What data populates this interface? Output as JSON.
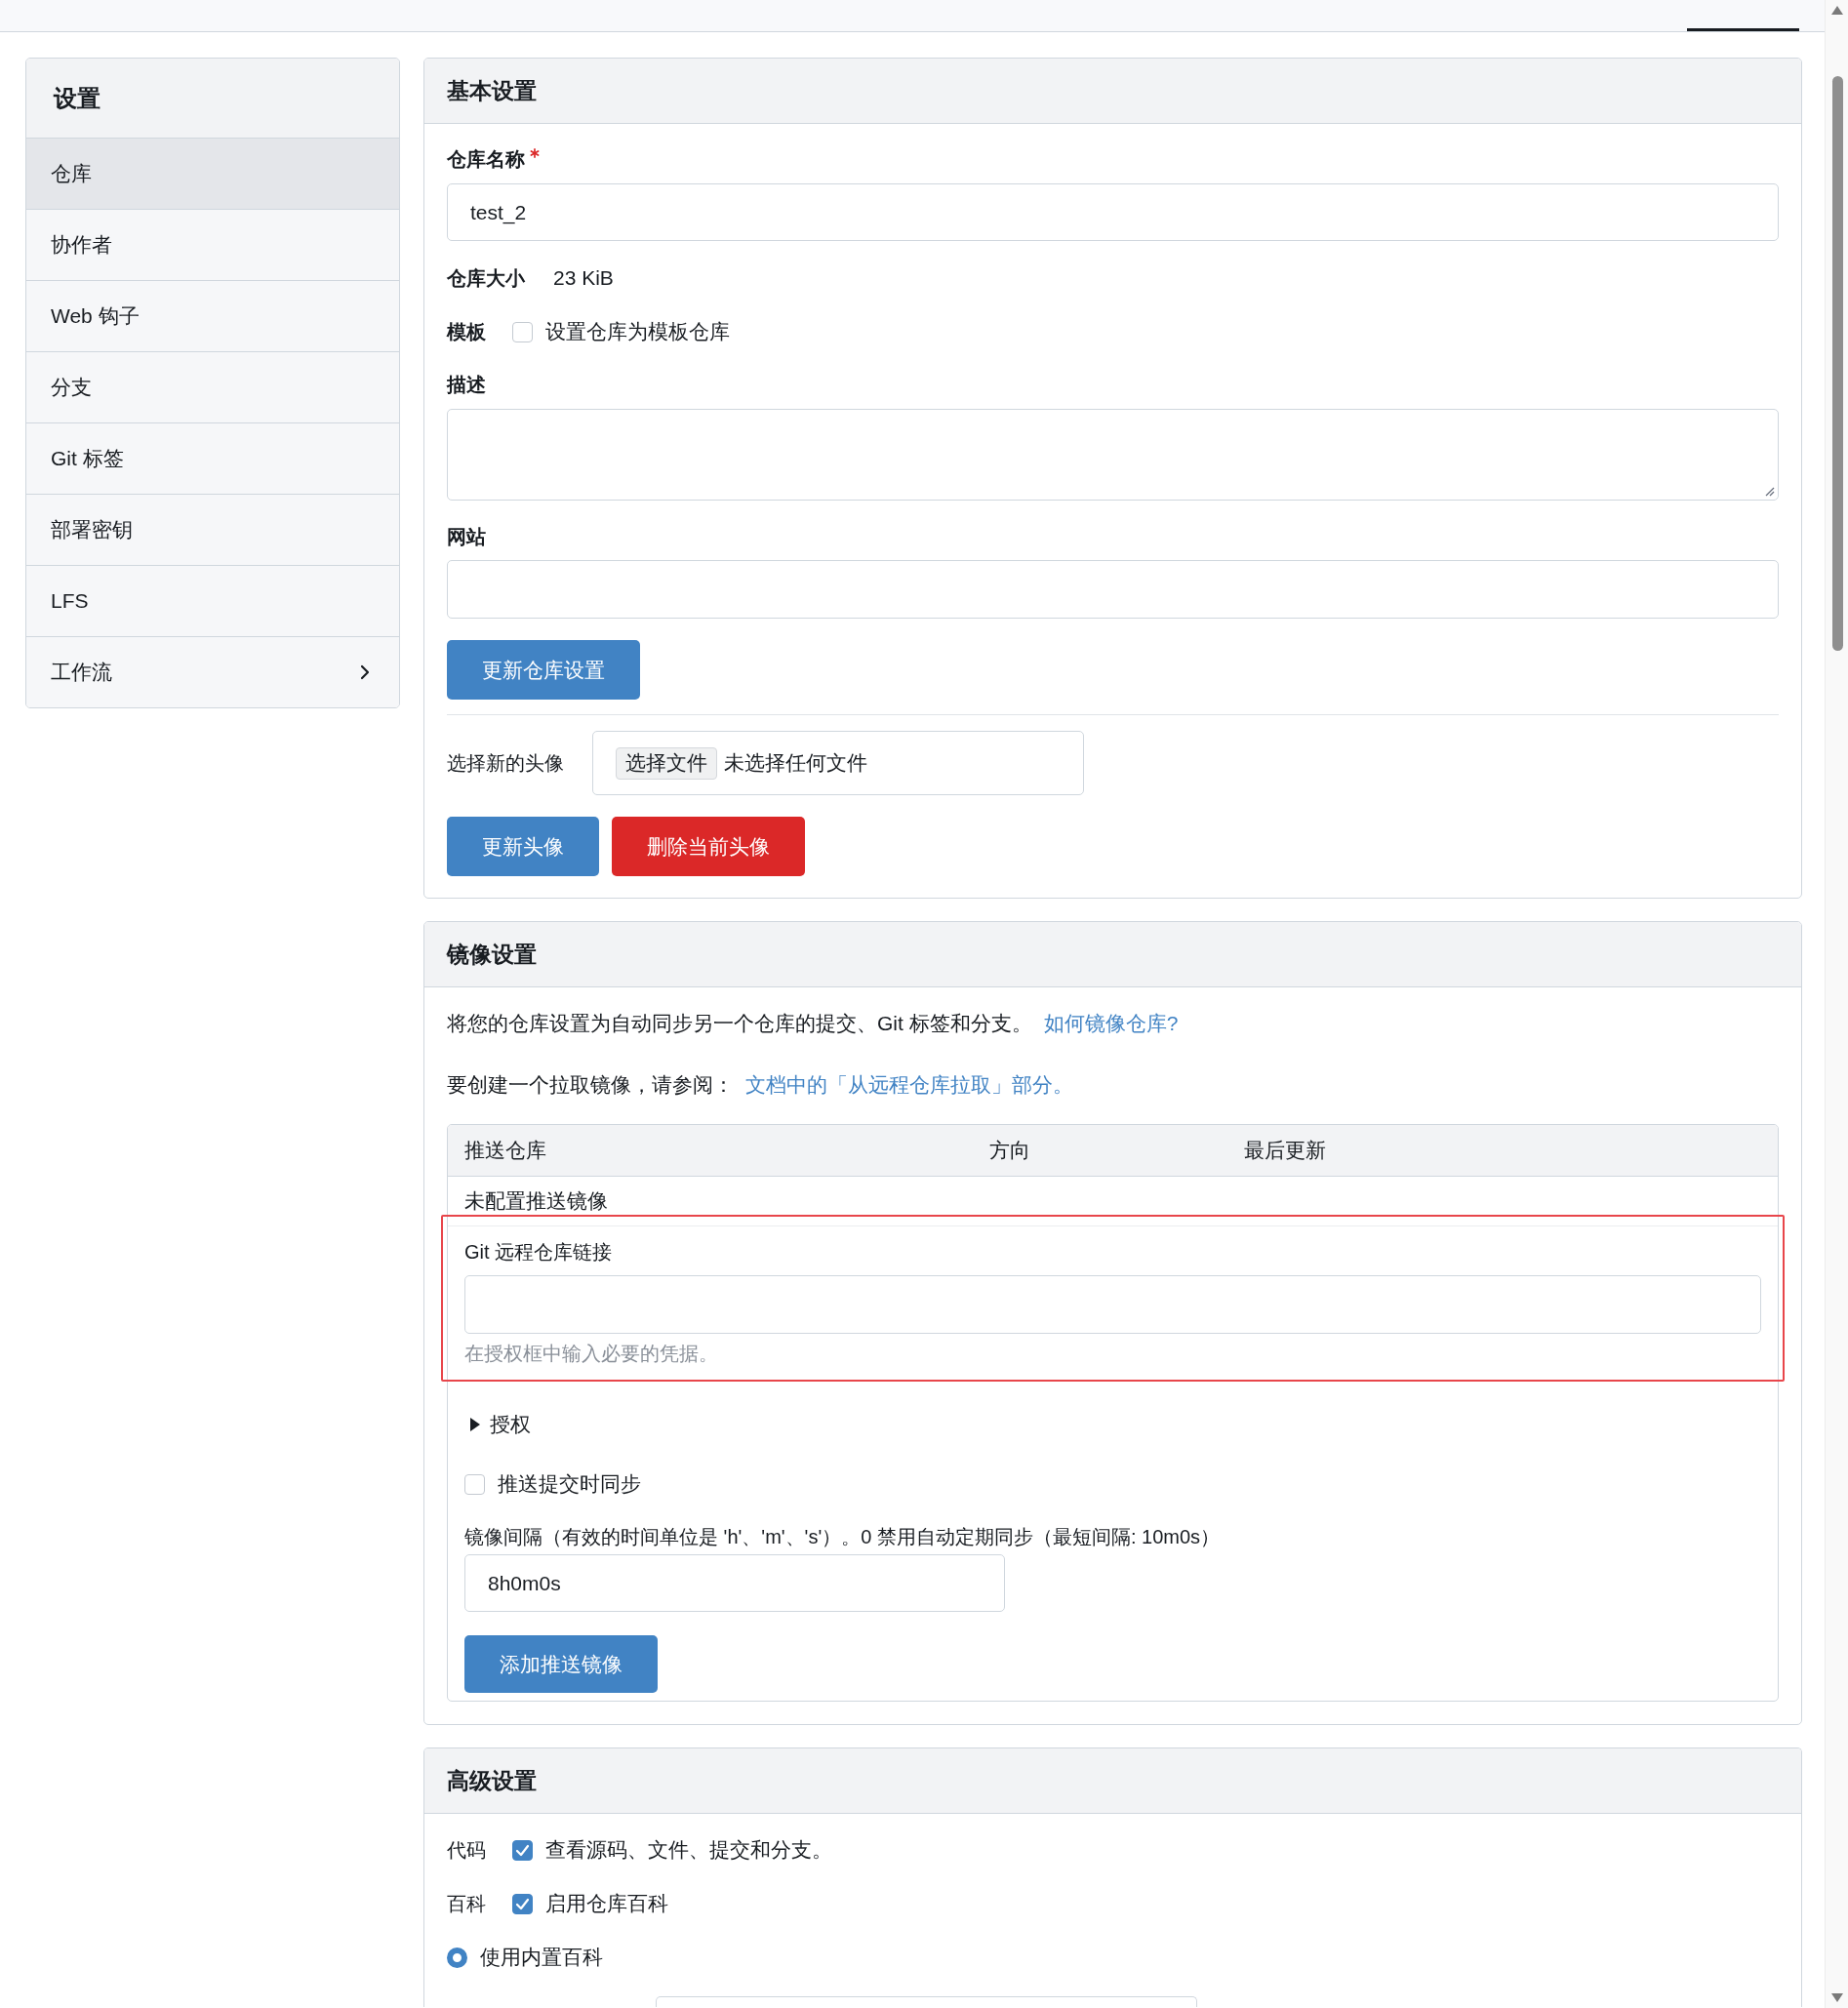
{
  "sidebar": {
    "title": "设置",
    "items": [
      {
        "label": "仓库",
        "kind": "link",
        "selected": true
      },
      {
        "label": "协作者",
        "kind": "link",
        "selected": false
      },
      {
        "label": "Web 钩子",
        "kind": "link",
        "selected": false
      },
      {
        "label": "分支",
        "kind": "link",
        "selected": false
      },
      {
        "label": "Git 标签",
        "kind": "link",
        "selected": false
      },
      {
        "label": "部署密钥",
        "kind": "link",
        "selected": false
      },
      {
        "label": "LFS",
        "kind": "link",
        "selected": false
      },
      {
        "label": "工作流",
        "kind": "submenu",
        "selected": false
      }
    ]
  },
  "basic_settings": {
    "title": "基本设置",
    "name_field": {
      "label": "仓库名称",
      "required": true,
      "value": "test_2"
    },
    "size": {
      "label": "仓库大小",
      "value": "23 KiB"
    },
    "template": {
      "label": "模板",
      "option": "设置仓库为模板仓库",
      "checked": false
    },
    "description_field": {
      "label": "描述"
    },
    "website_field": {
      "label": "网站"
    },
    "save_button": "更新仓库设置",
    "avatar": {
      "label": "选择新的头像",
      "file_button": "选择文件",
      "file_status": "未选择任何文件",
      "buttons": [
        {
          "label": "更新头像",
          "kind": "primary"
        },
        {
          "label": "删除当前头像",
          "kind": "danger"
        }
      ]
    }
  },
  "mirror_settings": {
    "title": "镜像设置",
    "description": "将您的仓库设置为自动同步另一个仓库的提交、Git 标签和分支。",
    "help_link": "如何镜像仓库?",
    "pull_note": "要创建一个拉取镜像，请参阅：",
    "pull_link": "文档中的「从远程仓库拉取」部分。",
    "table": {
      "columns": [
        "推送仓库",
        "方向",
        "最后更新"
      ],
      "empty_text": "未配置推送镜像"
    },
    "form": {
      "url_field": {
        "label": "Git 远程仓库链接",
        "help": "在授权框中输入必要的凭据。",
        "highlighted": true
      },
      "auth": {
        "label": "授权",
        "expanded": false
      },
      "sync_on_commit": {
        "label": "推送提交时同步",
        "checked": false
      },
      "interval_field": {
        "label": "镜像间隔（有效的时间单位是 'h'、'm'、's'）。0 禁用自动定期同步（最短间隔: 10m0s）",
        "value": "8h0m0s"
      },
      "submit_button": "添加推送镜像"
    }
  },
  "advanced_settings": {
    "title": "高级设置",
    "units": [
      {
        "label": "代码",
        "option": "查看源码、文件、提交和分支。",
        "checked": true
      },
      {
        "label": "百科",
        "option": "启用仓库百科",
        "checked": true
      }
    ],
    "wiki_options": [
      {
        "label": "使用内置百科",
        "selected": true
      }
    ]
  }
}
